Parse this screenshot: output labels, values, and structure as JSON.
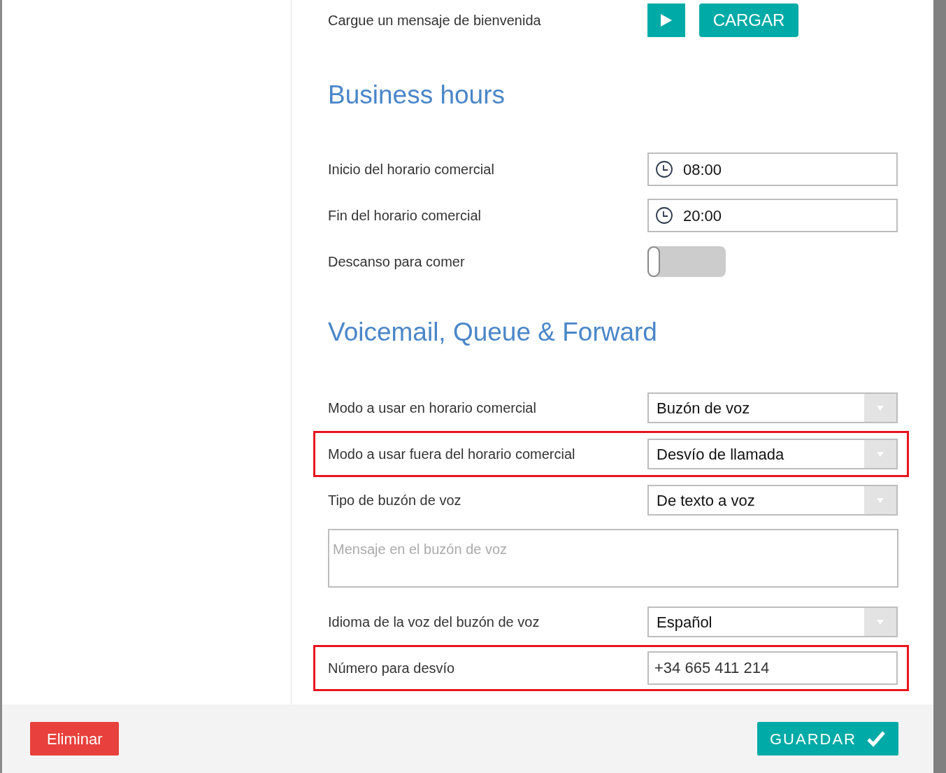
{
  "welcome": {
    "label": "Cargue un mensaje de bienvenida",
    "upload_button": "CARGAR"
  },
  "sections": [
    {
      "title": "Business hours",
      "fields": [
        {
          "kind": "time",
          "label": "Inicio del horario comercial",
          "value": "08:00",
          "highlighted": false
        },
        {
          "kind": "time",
          "label": "Fin del horario comercial",
          "value": "20:00",
          "highlighted": false
        },
        {
          "kind": "toggle",
          "label": "Descanso para comer",
          "on": false,
          "highlighted": false
        }
      ]
    },
    {
      "title": "Voicemail, Queue & Forward",
      "fields": [
        {
          "kind": "select",
          "label": "Modo a usar en horario comercial",
          "value": "Buzón de voz",
          "highlighted": false
        },
        {
          "kind": "select",
          "label": "Modo a usar fuera del horario comercial",
          "value": "Desvío de llamada",
          "highlighted": true
        },
        {
          "kind": "select",
          "label": "Tipo de buzón de voz",
          "value": "De texto a voz",
          "highlighted": false
        },
        {
          "kind": "textarea",
          "placeholder": "Mensaje en el buzón de voz",
          "highlighted": false
        },
        {
          "kind": "select",
          "label": "Idioma de la voz del buzón de voz",
          "value": "Español",
          "highlighted": false
        },
        {
          "kind": "text",
          "label": "Número para desvío",
          "value": "+34 665 411 214",
          "highlighted": true
        }
      ]
    }
  ],
  "footer": {
    "delete_button": "Eliminar",
    "save_button": "GUARDAR"
  }
}
